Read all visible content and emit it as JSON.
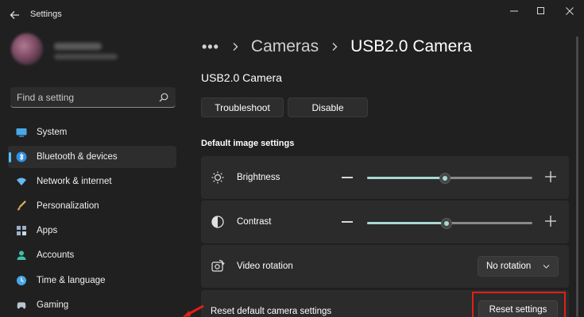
{
  "window": {
    "title": "Settings",
    "controls": {
      "minimize": "minimize-icon",
      "maximize": "maximize-icon",
      "close": "close-icon"
    }
  },
  "search": {
    "placeholder": "Find a setting"
  },
  "sidebar": {
    "items": [
      {
        "label": "System",
        "icon": "system-icon",
        "active": false
      },
      {
        "label": "Bluetooth & devices",
        "icon": "bluetooth-icon",
        "active": true
      },
      {
        "label": "Network & internet",
        "icon": "network-icon",
        "active": false
      },
      {
        "label": "Personalization",
        "icon": "personalization-icon",
        "active": false
      },
      {
        "label": "Apps",
        "icon": "apps-icon",
        "active": false
      },
      {
        "label": "Accounts",
        "icon": "accounts-icon",
        "active": false
      },
      {
        "label": "Time & language",
        "icon": "time-language-icon",
        "active": false
      },
      {
        "label": "Gaming",
        "icon": "gaming-icon",
        "active": false
      }
    ]
  },
  "breadcrumb": {
    "overflow": "•••",
    "parent": "Cameras",
    "current": "USB2.0 Camera"
  },
  "device": {
    "name": "USB2.0 Camera",
    "troubleshoot_label": "Troubleshoot",
    "disable_label": "Disable"
  },
  "image_settings": {
    "section_title": "Default image settings",
    "brightness": {
      "label": "Brightness",
      "value_fraction": 0.47
    },
    "contrast": {
      "label": "Contrast",
      "value_fraction": 0.48
    },
    "video_rotation": {
      "label": "Video rotation",
      "selected": "No rotation"
    }
  },
  "reset": {
    "label": "Reset default camera settings",
    "button_label": "Reset settings"
  },
  "colors": {
    "background": "#202020",
    "card": "#2b2b2b",
    "accent": "#4cc2ff",
    "slider_fill": "#a9d9d0",
    "highlight": "#e0201a"
  }
}
